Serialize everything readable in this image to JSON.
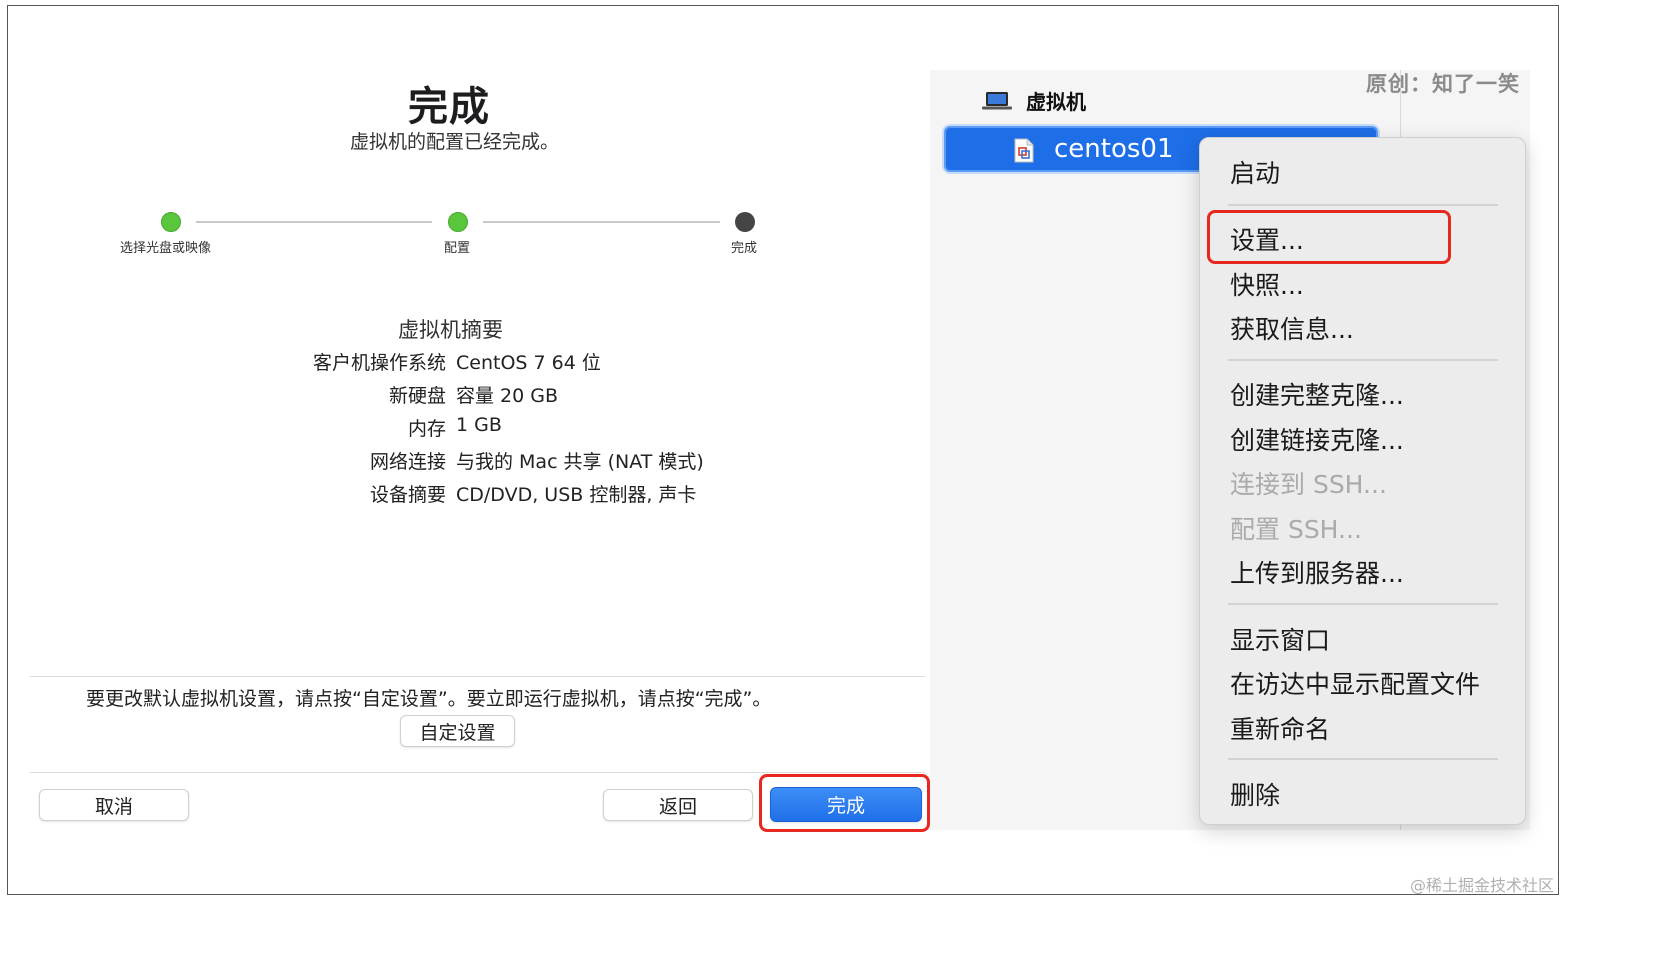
{
  "wizard": {
    "title": "完成",
    "subtitle": "虚拟机的配置已经完成。",
    "steps": [
      {
        "label": "选择光盘或映像",
        "state": "done"
      },
      {
        "label": "配置",
        "state": "done"
      },
      {
        "label": "完成",
        "state": "current"
      }
    ],
    "summary_title": "虚拟机摘要",
    "summary": [
      {
        "key": "客户机操作系统",
        "value": "CentOS 7 64 位"
      },
      {
        "key": "新硬盘",
        "value": "容量 20 GB"
      },
      {
        "key": "内存",
        "value": "1 GB"
      },
      {
        "key": "网络连接",
        "value": "与我的 Mac 共享 (NAT 模式)"
      },
      {
        "key": "设备摘要",
        "value": "CD/DVD, USB 控制器, 声卡"
      }
    ],
    "hint": "要更改默认虚拟机设置，请点按“自定设置”。要立即运行虚拟机，请点按“完成”。",
    "customize_label": "自定设置",
    "cancel_label": "取消",
    "back_label": "返回",
    "finish_label": "完成"
  },
  "library": {
    "header": "虚拟机",
    "vm_name": "centos01"
  },
  "context_menu": {
    "groups": [
      [
        "启动"
      ],
      [
        "设置...",
        "快照...",
        "获取信息..."
      ],
      [
        "创建完整克隆...",
        "创建链接克隆...",
        "连接到 SSH...",
        "配置 SSH...",
        "上传到服务器..."
      ],
      [
        "显示窗口",
        "在访达中显示配置文件",
        "重新命名"
      ],
      [
        "删除"
      ]
    ],
    "disabled": [
      "连接到 SSH...",
      "配置 SSH..."
    ],
    "highlighted": "设置..."
  },
  "watermarks": {
    "top": "原创：知了一笑",
    "bottom": "@稀土掘金技术社区"
  },
  "colors": {
    "accent": "#1e6ee8",
    "step_done": "#5ac63c",
    "step_current": "#454545",
    "highlight_box": "#e8281e"
  }
}
